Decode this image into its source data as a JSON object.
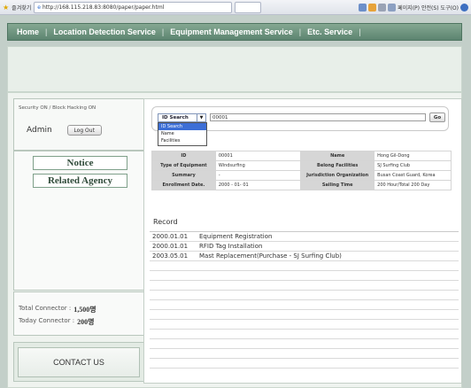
{
  "browser": {
    "favorites_label": "즐겨찾기",
    "tab_url": "http://168.115.218.83:8080/paper/paper.html",
    "toolbar": [
      "페이지(P)",
      "안전(S)",
      "도구(O)"
    ]
  },
  "nav": {
    "items": [
      "Home",
      "Location Detection Service",
      "Equipment Management Service",
      "Etc. Service"
    ],
    "separator": "|"
  },
  "sidebar": {
    "security_status": "Security ON / Block Hacking ON",
    "user_name": "Admin",
    "logout_label": "Log Out",
    "links": [
      "Notice",
      "Related Agency"
    ],
    "stats": [
      {
        "label": "Total Connector :",
        "value": "1,500명"
      },
      {
        "label": "Today Connector :",
        "value": "200명"
      }
    ],
    "contact_label": "CONTACT US"
  },
  "search": {
    "selected": "ID Search",
    "input_value": "00001",
    "go_label": "Go",
    "options": [
      "ID Search",
      "Name",
      "Facilities"
    ]
  },
  "info_table": [
    [
      "ID",
      "00001",
      "Name",
      "Hong Gil-Dong"
    ],
    [
      "Type of Equipment",
      "Windsurfing",
      "Belong Facilities",
      "SJ Surfing Club"
    ],
    [
      "Summary",
      "-",
      "Jurisdiction Organization",
      "Busan Coast Guard, Korea"
    ],
    [
      "Enrollment Date.",
      "2000 - 01- 01",
      "Sailing Time",
      "200 Hour/Total 200 Day"
    ]
  ],
  "record": {
    "title": "Record",
    "rows": [
      {
        "date": "2000.01.01",
        "text": "Equipment Registration"
      },
      {
        "date": "2000.01.01",
        "text": "RFID Tag Installation"
      },
      {
        "date": "2003.05.01",
        "text": "Mast Replacement(Purchase - SJ Surfing Club)"
      }
    ],
    "empty_rows": 11
  },
  "colors": {
    "nav_bg": "#6e947f",
    "page_bg": "#c3cfc9",
    "link_border": "#7fa08a",
    "dropdown_selected": "#3c6ed6"
  }
}
